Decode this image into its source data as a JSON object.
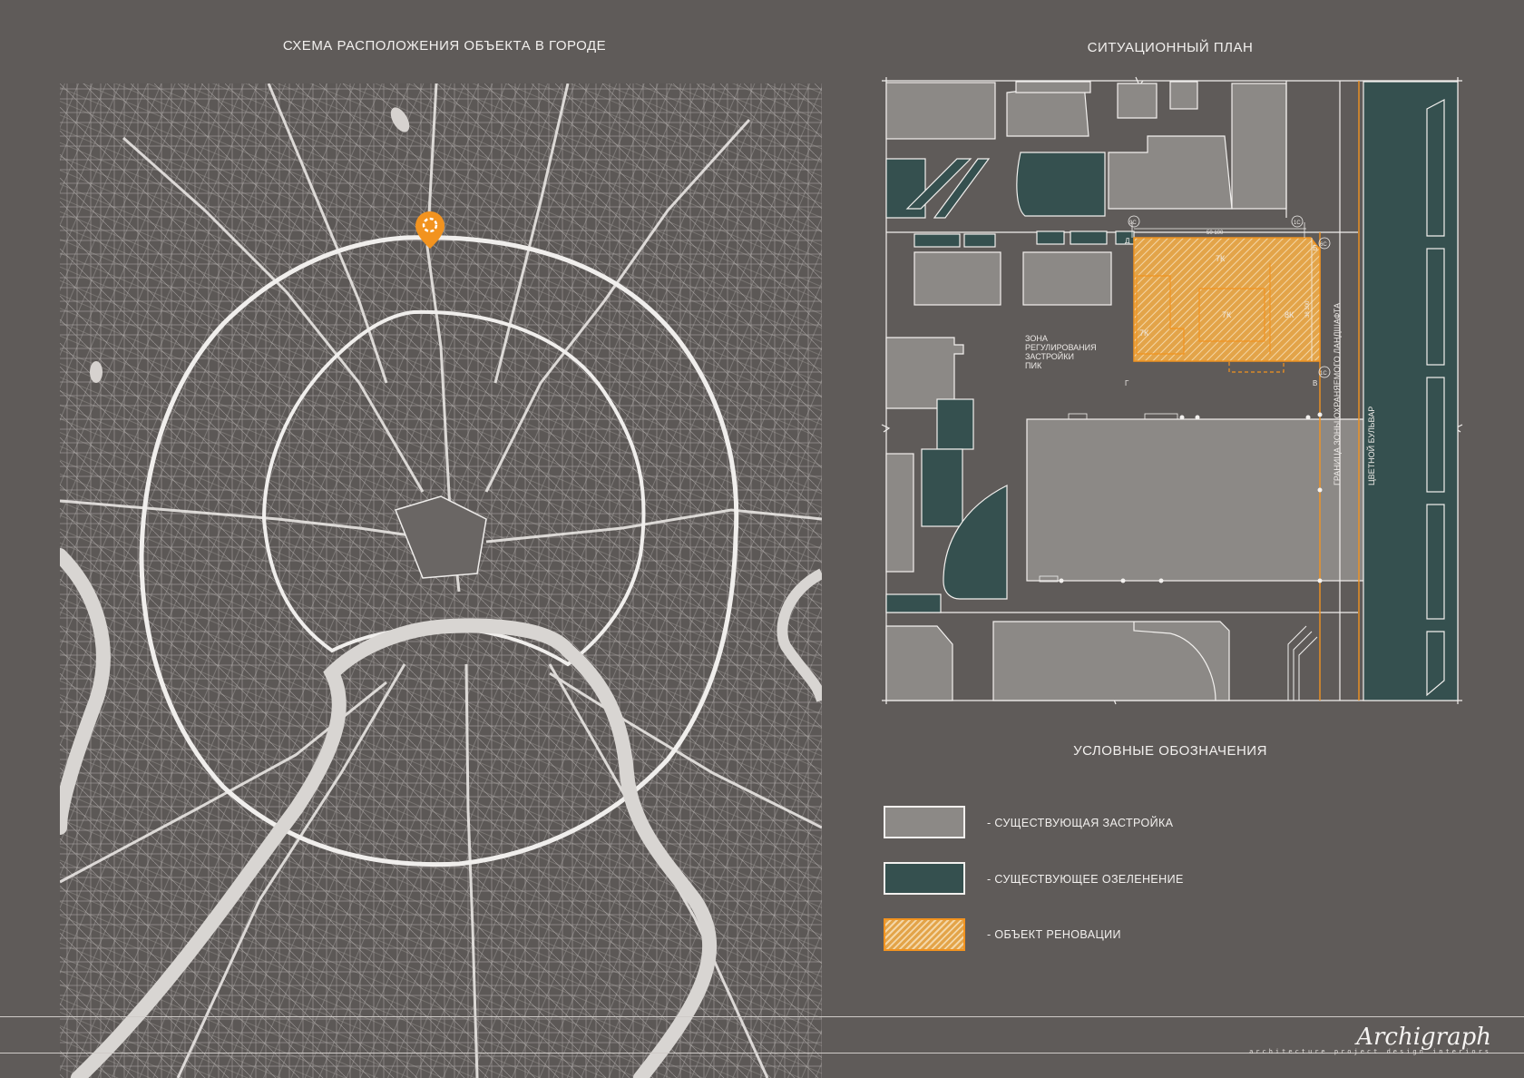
{
  "left_panel": {
    "title": "СХЕМА РАСПОЛОЖЕНИЯ ОБЪЕКТА В ГОРОДЕ",
    "marker_icon": "location-pin-icon",
    "marker_color": "#f2931f"
  },
  "right_panel": {
    "title": "СИТУАЦИОННЫЙ ПЛАН",
    "zone_label_lines": [
      "ЗОНА",
      "РЕГУЛИРОВАНИЯ",
      "ЗАСТРОЙКИ",
      "ПИК"
    ],
    "boundary_label": "ГРАНИЦА ЗОНЫ ОХРАНЯЕМОГО ЛАНДШАФТА",
    "street_label": "ЦВЕТНОЙ БУЛЬВАР",
    "building_floor_labels": [
      "7К",
      "7К",
      "7К",
      "8К"
    ],
    "axis_labels": {
      "top_left": "Д",
      "bottom_left": "Г",
      "top_right": "Б",
      "bottom_right": "В",
      "circle_left": "9С",
      "circle_right": "1С",
      "circle_b": "6С",
      "circle_v": "1С"
    },
    "dimension_top": "50 100",
    "dimension_side": "38 300"
  },
  "legend": {
    "title": "УСЛОВНЫЕ ОБОЗНАЧЕНИЯ",
    "items": [
      {
        "label": "- СУЩЕСТВУЮЩАЯ ЗАСТРОЙКА",
        "color": "#8c8986",
        "pattern": "solid"
      },
      {
        "label": "- СУЩЕСТВУЮЩЕЕ ОЗЕЛЕНЕНИЕ",
        "color": "#35504f",
        "pattern": "solid"
      },
      {
        "label": "- ОБЪЕКТ РЕНОВАЦИИ",
        "color": "#f2931f",
        "pattern": "hatched"
      }
    ]
  },
  "footer": {
    "logo_text": "Archigraph",
    "tagline": "architecture  project  design  interiors"
  },
  "colors": {
    "background": "#5f5b59",
    "building": "#8c8986",
    "greenery": "#35504f",
    "renovation": "#f2931f",
    "line": "#f2f0ee"
  }
}
